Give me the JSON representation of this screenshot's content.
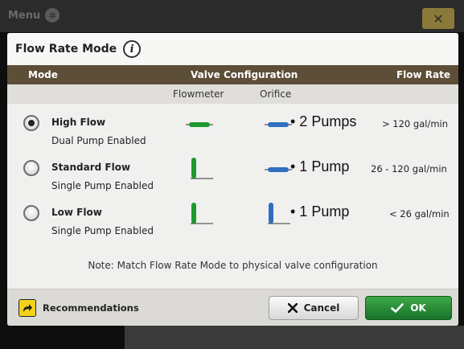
{
  "background": {
    "menu_label": "Menu",
    "close_glyph": "✕"
  },
  "dialog": {
    "title": "Flow Rate Mode",
    "info_glyph": "i",
    "table_header": {
      "mode": "Mode",
      "valve": "Valve Configuration",
      "rate": "Flow Rate"
    },
    "subheader": {
      "flowmeter": "Flowmeter",
      "orifice": "Orifice"
    },
    "rows": [
      {
        "name": "High Flow",
        "description": "Dual Pump Enabled",
        "pumps": "•  2 Pumps",
        "rate": "> 120 gal/min",
        "selected": true,
        "flowmeter_valve": "open-horizontal",
        "orifice_valve": "open-horizontal"
      },
      {
        "name": "Standard Flow",
        "description": "Single Pump Enabled",
        "pumps": "•  1 Pump",
        "rate": "26 - 120 gal/min",
        "selected": false,
        "flowmeter_valve": "closed-vertical",
        "orifice_valve": "open-horizontal"
      },
      {
        "name": "Low Flow",
        "description": "Single Pump Enabled",
        "pumps": "•  1 Pump",
        "rate": "< 26 gal/min",
        "selected": false,
        "flowmeter_valve": "closed-vertical",
        "orifice_valve": "closed-vertical"
      }
    ],
    "note": "Note: Match Flow Rate Mode to physical valve configuration",
    "footer": {
      "recommendations": "Recommendations",
      "cancel": "Cancel",
      "ok": "OK"
    },
    "colors": {
      "header_bg": "#5d4f37",
      "flowmeter_valve": "#1e9a2e",
      "orifice_valve": "#2f6fbf",
      "ok_bg": "#1f8a33",
      "rec_icon": "#f5d21a"
    }
  }
}
